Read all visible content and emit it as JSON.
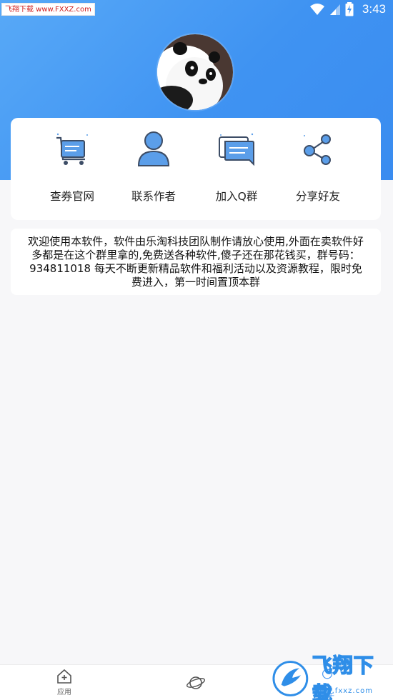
{
  "status_bar": {
    "watermark": "飞翔下载 www.FXXZ.com",
    "time": "3:43"
  },
  "actions": [
    {
      "label": "查券官网",
      "icon": "cart-coupon-icon"
    },
    {
      "label": "联系作者",
      "icon": "user-icon"
    },
    {
      "label": "加入Q群",
      "icon": "chat-icon"
    },
    {
      "label": "分享好友",
      "icon": "share-icon"
    }
  ],
  "info_text": "欢迎使用本软件，软件由乐淘科技团队制作请放心使用,外面在卖软件好多都是在这个群里拿的,免费送各种软件,傻子还在那花钱买，群号码：934811018 每天不断更新精品软件和福利活动以及资源教程，限时免费进入，第一时间置顶本群",
  "bottom_nav": {
    "items": [
      {
        "label": "应用",
        "icon": "home-plus-icon"
      },
      {
        "label": "",
        "icon": "planet-icon"
      },
      {
        "label": "关于",
        "icon": "about-icon"
      }
    ],
    "active_index": 2
  },
  "brand_watermark": {
    "name": "飞翔下载",
    "url": "www.fxxz.com"
  },
  "colors": {
    "accent": "#3f93f2",
    "header_gradient_start": "#58a9f7",
    "header_gradient_end": "#3a8cf0",
    "background": "#f7f7f9",
    "icon_blue": "#5b9ee9"
  }
}
